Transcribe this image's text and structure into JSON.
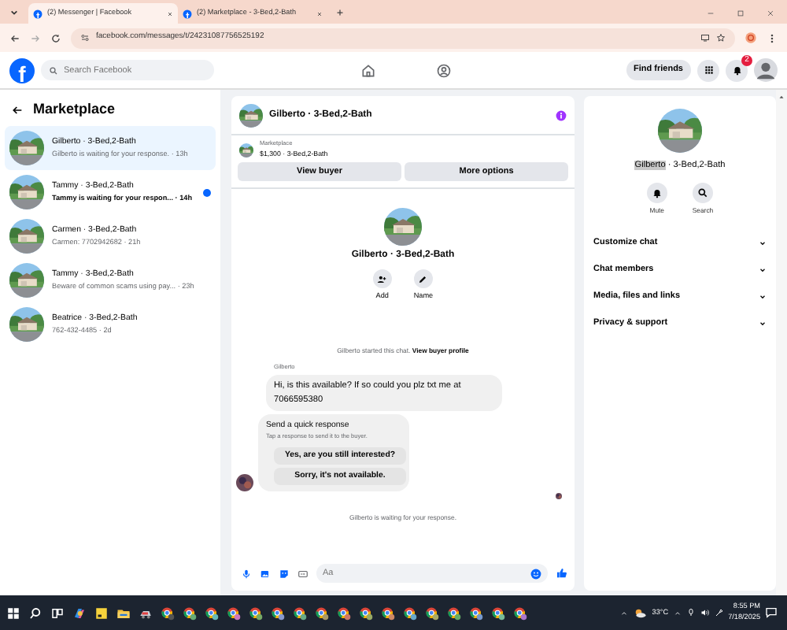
{
  "browser": {
    "tabs": [
      {
        "title": "(2) Messenger | Facebook",
        "selected": true
      },
      {
        "title": "(2) Marketplace - 3-Bed,2-Bath",
        "selected": false
      }
    ],
    "url": "facebook.com/messages/t/24231087756525192"
  },
  "header": {
    "logo": "f",
    "search": {
      "placeholder": "Search Facebook"
    },
    "find_friends": "Find friends",
    "notifications": "2"
  },
  "sidebar": {
    "title": "Marketplace",
    "conversations": [
      {
        "name": "Gilberto · 3-Bed,2-Bath",
        "preview": "Gilberto is waiting for your response.",
        "time": "· 13h",
        "selected": true,
        "unread": false
      },
      {
        "name": "Tammy · 3-Bed,2-Bath",
        "preview": "Tammy is waiting for your respon...",
        "time": "· 14h",
        "selected": false,
        "unread": true
      },
      {
        "name": "Carmen · 3-Bed,2-Bath",
        "preview": "Carmen: 7702942682",
        "time": "· 21h",
        "selected": false,
        "unread": false
      },
      {
        "name": "Tammy · 3-Bed,2-Bath",
        "preview": "Beware of common scams using pay...",
        "time": "· 23h",
        "selected": false,
        "unread": false
      },
      {
        "name": "Beatrice · 3-Bed,2-Bath",
        "preview": "762-432-4485",
        "time": "· 2d",
        "selected": false,
        "unread": false
      }
    ]
  },
  "chat": {
    "title": "Gilberto · 3-Bed,2-Bath",
    "listing": {
      "label": "Marketplace",
      "price": "$1,300 · 3-Bed,2-Bath"
    },
    "buttons": [
      "View buyer",
      "More options"
    ],
    "profile": {
      "name": "Gilberto · 3-Bed,2-Bath",
      "actions": [
        "Add",
        "Name"
      ]
    },
    "started": {
      "text": "Gilberto started this chat.",
      "link": "View buyer profile"
    },
    "sender": "Gilberto",
    "message": "Hi, is this available? If so could you plz txt me at 7066595380",
    "quick_response": {
      "title": "Send a quick response",
      "hint": "Tap a response to send it to the buyer.",
      "options": [
        "Yes, are you still interested?",
        "Sorry, it's not available."
      ]
    },
    "status": "Gilberto is waiting for your response.",
    "composer": {
      "placeholder": "Aa"
    }
  },
  "details": {
    "name_selected": "Gilberto",
    "name_rest": " · 3-Bed,2-Bath",
    "actions": [
      "Mute",
      "Search"
    ],
    "sections": [
      {
        "label": "Customize chat",
        "expanded": false
      },
      {
        "label": "Chat members",
        "expanded": false
      },
      {
        "label": "Media, files and links",
        "expanded": false
      },
      {
        "label": "Privacy & support",
        "expanded": false
      }
    ]
  },
  "taskbar": {
    "apps": [
      {
        "kind": "start"
      },
      {
        "kind": "search"
      },
      {
        "kind": "taskview"
      },
      {
        "kind": "copilot"
      },
      {
        "kind": "notes"
      },
      {
        "kind": "explorer"
      },
      {
        "kind": "app"
      },
      {
        "kind": "chrome",
        "color": "#555555"
      },
      {
        "kind": "chrome",
        "color": "#66aa77"
      },
      {
        "kind": "chrome",
        "color": "#66bbbb"
      },
      {
        "kind": "chrome",
        "color": "#cc77bb"
      },
      {
        "kind": "chrome",
        "color": "#77aa66"
      },
      {
        "kind": "chrome",
        "color": "#8899cc"
      },
      {
        "kind": "chrome",
        "color": "#66aa88"
      },
      {
        "kind": "chrome",
        "color": "#aa9966"
      },
      {
        "kind": "chrome",
        "color": "#cc7766"
      },
      {
        "kind": "chrome",
        "color": "#99aa66"
      },
      {
        "kind": "chrome",
        "color": "#cc8866"
      },
      {
        "kind": "chrome",
        "color": "#66aacc"
      },
      {
        "kind": "chrome",
        "color": "#aaaa66"
      },
      {
        "kind": "chrome",
        "color": "#66aa66"
      },
      {
        "kind": "chrome",
        "color": "#7799cc"
      },
      {
        "kind": "chrome",
        "color": "#77bb99"
      },
      {
        "kind": "chrome",
        "color": "#aa77cc"
      }
    ],
    "temperature": "33°C",
    "time": "8:55 PM",
    "date": "7/18/2025"
  }
}
